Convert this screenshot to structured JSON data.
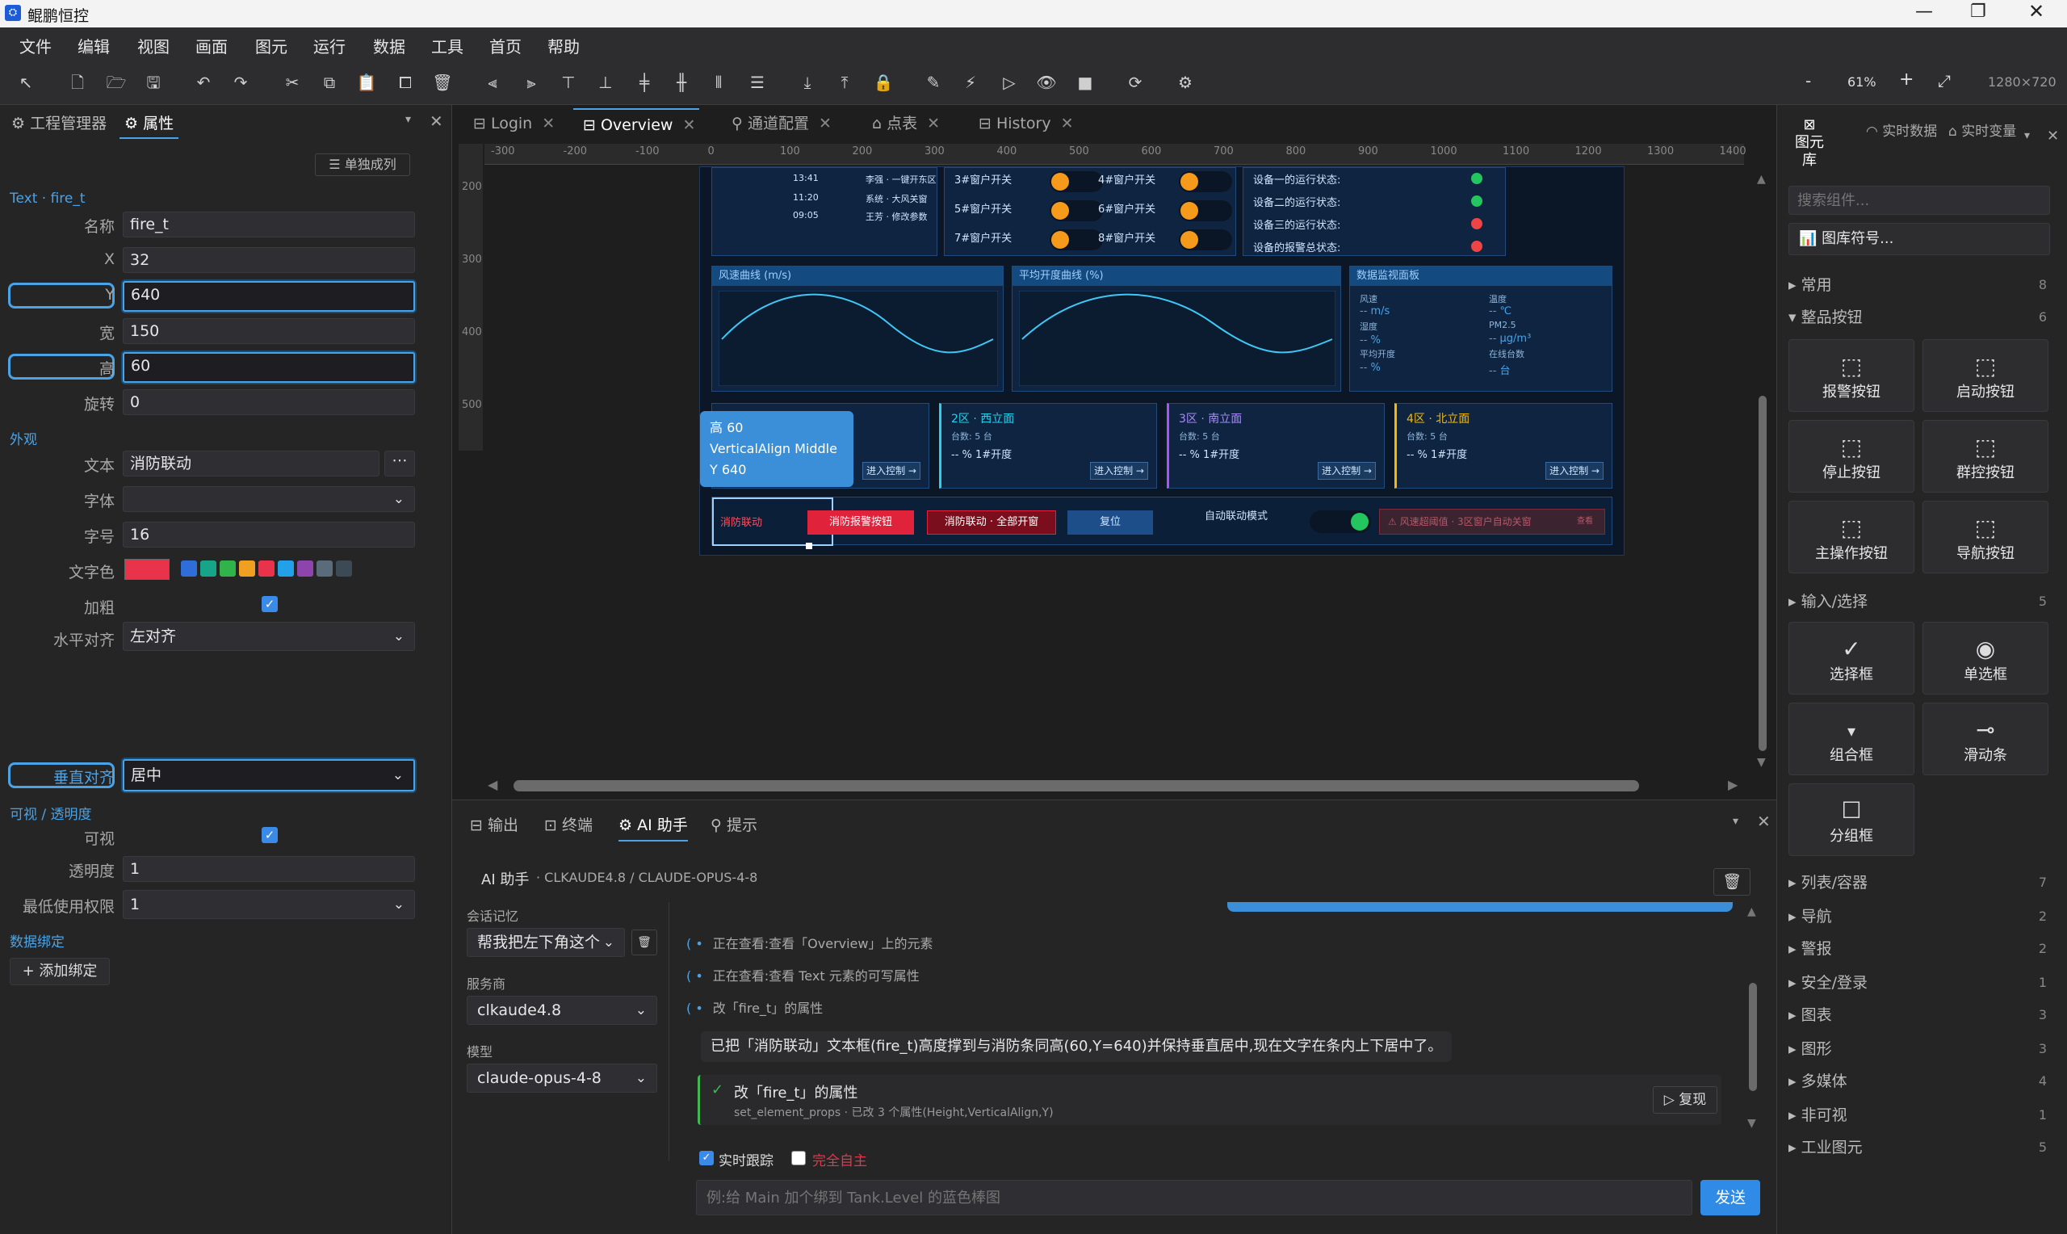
{
  "window": {
    "title": "鲲鹏恒控"
  },
  "menu": [
    "文件",
    "编辑",
    "视图",
    "画面",
    "图元",
    "运行",
    "数据",
    "工具",
    "首页",
    "帮助"
  ],
  "zoom": {
    "minus": "-",
    "value": "61%",
    "plus": "+",
    "size": "1280×720"
  },
  "left_tabs": {
    "project": "工程管理器",
    "props": "属性"
  },
  "props": {
    "single_col": "单独成列",
    "element_ref": "Text · fire_t",
    "name_label": "名称",
    "name": "fire_t",
    "x_label": "X",
    "x": "32",
    "y_label": "Y",
    "y": "640",
    "w_label": "宽",
    "w": "150",
    "h_label": "高",
    "h": "60",
    "rot_label": "旋转",
    "rot": "0",
    "appearance": "外观",
    "text_label": "文本",
    "text": "消防联动",
    "font_label": "字体",
    "font": "",
    "size_label": "字号",
    "size": "16",
    "color_label": "文字色",
    "bold_label": "加粗",
    "halign_label": "水平对齐",
    "halign": "左对齐",
    "valign_label": "垂直对齐",
    "valign": "居中",
    "visibility": "可视 / 透明度",
    "visible_label": "可视",
    "opacity_label": "透明度",
    "opacity": "1",
    "perm_label": "最低使用权限",
    "perm": "1",
    "binding": "数据绑定",
    "add_binding": "+ 添加绑定"
  },
  "colors": {
    "text_color": "#e8334a",
    "swatches": [
      "#2f6ed8",
      "#17a589",
      "#2fb34a",
      "#f0a020",
      "#e8334a",
      "#22a0e8",
      "#8e44ad",
      "#5a6b7b",
      "#3b4a55"
    ]
  },
  "doc_tabs": [
    "Login",
    "Overview",
    "通道配置",
    "点表",
    "History"
  ],
  "ruler_top": [
    "-300",
    "-200",
    "-100",
    "0",
    "100",
    "200",
    "300",
    "400",
    "500",
    "600",
    "700",
    "800",
    "900",
    "1000",
    "1100",
    "1200",
    "1300",
    "1400"
  ],
  "ruler_left": [
    "200",
    "300",
    "400",
    "500"
  ],
  "canvas": {
    "logs": [
      [
        "13:41",
        "李强 · 一键开东区"
      ],
      [
        "11:20",
        "系统 · 大风关窗"
      ],
      [
        "09:05",
        "王芳 · 修改参数"
      ]
    ],
    "switches": [
      "3#窗户开关",
      "4#窗户开关",
      "5#窗户开关",
      "6#窗户开关",
      "7#窗户开关",
      "8#窗户开关"
    ],
    "devices": [
      "设备一的运行状态:",
      "设备二的运行状态:",
      "设备三的运行状态:",
      "设备的报警总状态:"
    ],
    "chart1": "风速曲线 (m/s)",
    "chart2": "平均开度曲线 (%)",
    "monitor": {
      "title": "数据监视面板",
      "wind_l": "风速",
      "wind_v": "-- m/s",
      "temp_l": "温度",
      "temp_v": "-- ℃",
      "hum_l": "湿度",
      "hum_v": "-- %",
      "pm_l": "PM2.5",
      "pm_v": "-- μg/m³",
      "open_l": "平均开度",
      "open_v": "-- %",
      "online_l": "在线台数",
      "online_v": "-- 台"
    },
    "zones": [
      {
        "name": "2区 · 西立面",
        "count": "台数: 5 台",
        "open": "-- % 1#开度",
        "btn": "进入控制 →"
      },
      {
        "name": "3区 · 南立面",
        "count": "台数: 5 台",
        "open": "-- % 1#开度",
        "btn": "进入控制 →"
      },
      {
        "name": "4区 · 北立面",
        "count": "台数: 5 台",
        "open": "-- % 1#开度",
        "btn": "进入控制 →"
      }
    ],
    "zone1_btn": "进入控制 →",
    "tooltip": {
      "h": "高  60",
      "va": "VerticalAlign  Middle",
      "y": "Y  640"
    },
    "fire_text": "消防联动",
    "fire_alarm": "消防报警按钮",
    "fire_open": "消防联动 · 全部开窗",
    "reset": "复位",
    "auto_mode": "自动联动模式",
    "warning": "风速超阈值 · 3区窗户自动关窗",
    "warning_action": "查看"
  },
  "right_tabs": {
    "lib": "图元库",
    "live_data": "实时数据",
    "live_var": "实时变量"
  },
  "library": {
    "search": "搜索组件...",
    "symbol": "图库符号...",
    "cat_common": "常用",
    "cat_common_n": "8",
    "cat_buttons": "整品按钮",
    "cat_buttons_n": "6",
    "buttons": [
      "报警按钮",
      "启动按钮",
      "停止按钮",
      "群控按钮",
      "主操作按钮",
      "导航按钮"
    ],
    "cat_input": "输入/选择",
    "cat_input_n": "5",
    "inputs": [
      "选择框",
      "单选框",
      "组合框",
      "滑动条",
      "分组框"
    ],
    "cats": [
      [
        "列表/容器",
        "7"
      ],
      [
        "导航",
        "2"
      ],
      [
        "警报",
        "2"
      ],
      [
        "安全/登录",
        "1"
      ],
      [
        "图表",
        "3"
      ],
      [
        "图形",
        "3"
      ],
      [
        "多媒体",
        "4"
      ],
      [
        "非可视",
        "1"
      ],
      [
        "工业图元",
        "5"
      ]
    ]
  },
  "bottom_tabs": [
    "输出",
    "终端",
    "AI 助手",
    "提示"
  ],
  "ai": {
    "header": "AI 助手",
    "model_line": "· CLKAUDE4.8 / CLAUDE-OPUS-4-8",
    "mem_label": "会话记忆",
    "mem_value": "帮我把左下角这个",
    "provider_label": "服务商",
    "provider": "clkaude4.8",
    "model_label": "模型",
    "model": "claude-opus-4-8",
    "steps": [
      "正在查看:查看「Overview」上的元素",
      "正在查看:查看 Text 元素的可写属性",
      "改「fire_t」的属性"
    ],
    "reply": "已把「消防联动」文本框(fire_t)高度撑到与消防条同高(60,Y=640)并保持垂直居中,现在文字在条内上下居中了。",
    "action_title": "改「fire_t」的属性",
    "action_detail": "set_element_props · 已改 3 个属性(Height,VerticalAlign,Y)",
    "replay": "▷ 复现",
    "live_track": "实时跟踪",
    "full_auto": "完全自主",
    "input_placeholder": "例:给 Main 加个绑到 Tank.Level 的蓝色棒图",
    "send": "发送"
  }
}
